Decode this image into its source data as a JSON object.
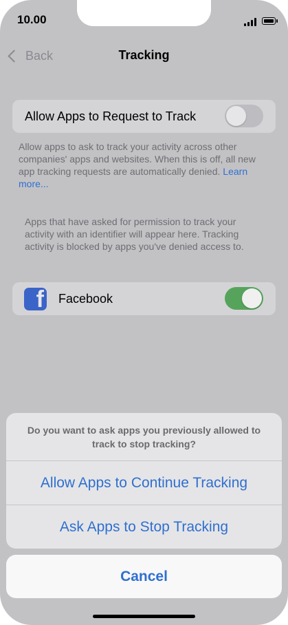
{
  "status_bar": {
    "time": "10.00"
  },
  "nav": {
    "back_label": "Back",
    "title": "Tracking"
  },
  "allow_row": {
    "label": "Allow Apps to Request to Track",
    "toggle_state": "off"
  },
  "allow_footnote": {
    "text": "Allow apps to ask to track your activity across other companies' apps and websites. When this is off, all new app tracking requests are automatically denied.",
    "link": "Learn more..."
  },
  "apps_info": "Apps that have asked for permission to track your activity with an identifier will appear here. Tracking activity is blocked by apps you've denied access to.",
  "apps": [
    {
      "name": "Facebook",
      "icon": "facebook-icon",
      "toggle_state": "on"
    }
  ],
  "action_sheet": {
    "message": "Do you want to ask apps you previously allowed to track to stop tracking?",
    "actions": [
      "Allow Apps to Continue Tracking",
      "Ask Apps to Stop Tracking"
    ],
    "cancel": "Cancel"
  },
  "colors": {
    "accent": "#2f6fcf",
    "toggle_on": "#56a45c",
    "facebook": "#3b64c8"
  }
}
